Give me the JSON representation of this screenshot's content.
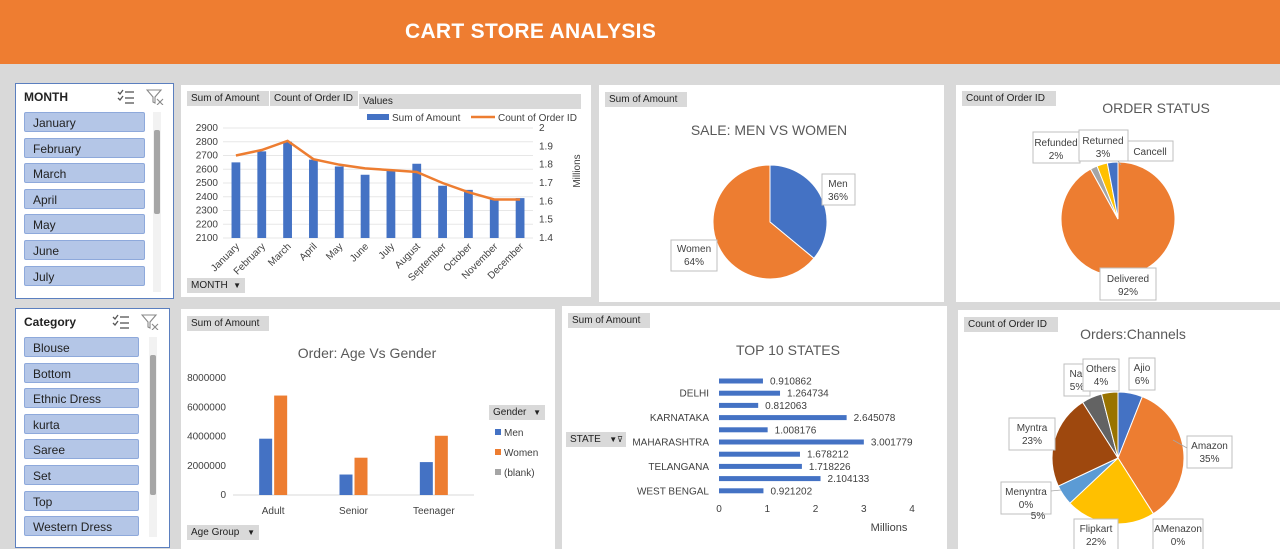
{
  "header": {
    "title": "CART STORE ANALYSIS"
  },
  "month_slicer": {
    "title": "MONTH",
    "items": [
      "January",
      "February",
      "March",
      "April",
      "May",
      "June",
      "July"
    ]
  },
  "category_slicer": {
    "title": "Category",
    "items": [
      "Blouse",
      "Bottom",
      "Ethnic Dress",
      "kurta",
      "Saree",
      "Set",
      "Top",
      "Western Dress"
    ]
  },
  "colors": {
    "blue": "#4472c4",
    "orange": "#ed7d31",
    "gray": "#a5a5a5",
    "yellow": "#ffc000",
    "darkblue": "#255e91",
    "brown": "#9e480e",
    "darkgray": "#636363",
    "olive": "#997300",
    "banner": "#ee7d31"
  },
  "monthly_panel": {
    "field_buttons": [
      "Sum of Amount",
      "Count of Order ID",
      "Values"
    ],
    "axis_button": "MONTH",
    "legend": [
      "Sum of Amount",
      "Count of Order ID"
    ],
    "right_axis_unit": "Millions"
  },
  "men_women_panel": {
    "field_button": "Sum of Amount",
    "labels": [
      {
        "name": "Men",
        "pct": "36%"
      },
      {
        "name": "Women",
        "pct": "64%"
      }
    ]
  },
  "order_status_panel": {
    "field_button": "Count of Order ID",
    "labels": [
      {
        "name": "Refunded",
        "pct": "2%"
      },
      {
        "name": "Returned",
        "pct": "3%"
      },
      {
        "name": "Cancell",
        "pct": ""
      },
      {
        "name": "Delivered",
        "pct": "92%"
      }
    ]
  },
  "age_gender_panel": {
    "field_button": "Sum of Amount",
    "axis_button": "Age Group",
    "legend_title": "Gender"
  },
  "states_panel": {
    "field_button": "Sum of Amount",
    "axis_button": "STATE",
    "unit_label": "Millions"
  },
  "channels_panel": {
    "field_button": "Count of Order ID",
    "labels": [
      {
        "name": "Ajio",
        "pct": "6%"
      },
      {
        "name": "Amazon",
        "pct": "35%"
      },
      {
        "name": "AMenazon",
        "pct": "0%"
      },
      {
        "name": "Flipkart",
        "pct": "22%"
      },
      {
        "name": "Menyntra",
        "pct": "0%"
      },
      {
        "name": "",
        "pct": "5%"
      },
      {
        "name": "Myntra",
        "pct": "23%"
      },
      {
        "name": "Nal",
        "pct": "5%"
      },
      {
        "name": "Others",
        "pct": "4%"
      }
    ]
  },
  "chart_data": [
    {
      "type": "bar",
      "categories": [
        "January",
        "February",
        "March",
        "April",
        "May",
        "June",
        "July",
        "August",
        "September",
        "October",
        "November",
        "December"
      ],
      "series": [
        {
          "name": "Sum of Amount",
          "type": "bar",
          "axis": "left",
          "values": [
            2650,
            2730,
            2800,
            2670,
            2620,
            2560,
            2590,
            2640,
            2480,
            2450,
            2380,
            2390
          ]
        },
        {
          "name": "Count of Order ID",
          "type": "line",
          "axis": "right",
          "values": [
            1.85,
            1.88,
            1.93,
            1.83,
            1.8,
            1.78,
            1.77,
            1.76,
            1.7,
            1.65,
            1.61,
            1.61
          ]
        }
      ],
      "ylim": [
        2100,
        2900
      ],
      "y2lim": [
        1.4,
        2
      ],
      "yticks": [
        2100,
        2200,
        2300,
        2400,
        2500,
        2600,
        2700,
        2800,
        2900
      ],
      "y2ticks": [
        "1.4",
        "1.5",
        "1.6",
        "1.7",
        "1.8",
        "1.9",
        "2"
      ],
      "y2label": "Millions",
      "legend": "top-right"
    },
    {
      "type": "pie",
      "title": "SALE: MEN VS WOMEN",
      "categories": [
        "Men",
        "Women"
      ],
      "values": [
        36,
        64
      ]
    },
    {
      "type": "pie",
      "title": "ORDER STATUS",
      "categories": [
        "Delivered",
        "Refunded",
        "Returned",
        "Cancelled"
      ],
      "values": [
        92,
        2,
        3,
        3
      ]
    },
    {
      "type": "bar",
      "title": "Order: Age Vs Gender",
      "categories": [
        "Adult",
        "Senior",
        "Teenager"
      ],
      "series": [
        {
          "name": "Men",
          "values": [
            3850000,
            1400000,
            2250000
          ]
        },
        {
          "name": "Women",
          "values": [
            6800000,
            2550000,
            4050000
          ]
        },
        {
          "name": "(blank)",
          "values": [
            0,
            0,
            0
          ]
        }
      ],
      "ylim": [
        0,
        8000000
      ],
      "yticks": [
        "0",
        "2000000",
        "4000000",
        "6000000",
        "8000000"
      ],
      "legend": "right"
    },
    {
      "type": "bar",
      "orientation": "horizontal",
      "title": "TOP 10 STATES",
      "categories": [
        "",
        "DELHI",
        "",
        "KARNATAKA",
        "",
        "MAHARASHTRA",
        "",
        "TELANGANA",
        "",
        "WEST BENGAL"
      ],
      "values": [
        0.910862,
        1.264734,
        0.812063,
        2.645078,
        1.008176,
        3.001779,
        1.678212,
        1.718226,
        2.104133,
        0.921202
      ],
      "value_labels": [
        "0.910862",
        "1.264734",
        "0.812063",
        "2.645078",
        "1.008176",
        "3.001779",
        "1.678212",
        "1.718226",
        "2.104133",
        "0.921202"
      ],
      "xlim": [
        0,
        4
      ],
      "xticks": [
        "0",
        "1",
        "2",
        "3",
        "4"
      ],
      "xlabel": "Millions"
    },
    {
      "type": "pie",
      "title": "Orders:Channels",
      "categories": [
        "Ajio",
        "Amazon",
        "AMenazon",
        "Flipkart",
        "Menyntra",
        "",
        "Myntra",
        "Nal",
        "Others"
      ],
      "values": [
        6,
        35,
        0,
        22,
        0,
        5,
        23,
        5,
        4
      ]
    }
  ]
}
